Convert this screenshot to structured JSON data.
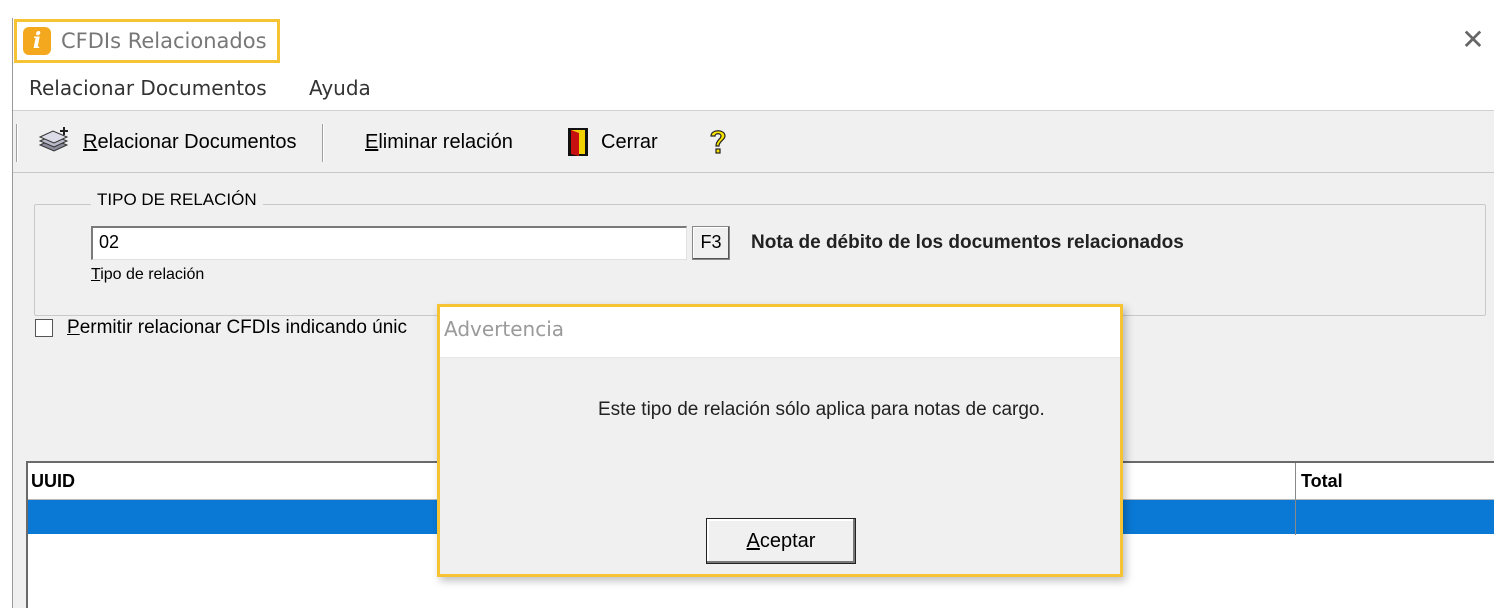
{
  "window": {
    "title": "CFDIs Relacionados"
  },
  "menu": {
    "items": [
      "Relacionar Documentos",
      "Ayuda"
    ]
  },
  "toolbar": {
    "relacionar": {
      "accel": "R",
      "rest": "elacionar Documentos"
    },
    "eliminar": {
      "accel": "E",
      "rest": "liminar relación"
    },
    "cerrar": "Cerrar"
  },
  "group": {
    "legend": "TIPO DE RELACIÓN",
    "value": "02",
    "f3": "F3",
    "description": "Nota de débito de los documentos relacionados",
    "caption": {
      "accel": "T",
      "rest": "ipo de relación"
    }
  },
  "checkbox": {
    "accel": "P",
    "rest": "ermitir relacionar CFDIs indicando únic",
    "checked": false
  },
  "grid": {
    "columns": [
      "UUID",
      "Total"
    ]
  },
  "dialog": {
    "title": "Advertencia",
    "message": "Este tipo de relación sólo aplica para notas de cargo.",
    "button": {
      "accel": "A",
      "rest": "ceptar"
    }
  },
  "colors": {
    "highlight": "#f5c334",
    "selection": "#0a79d6"
  }
}
